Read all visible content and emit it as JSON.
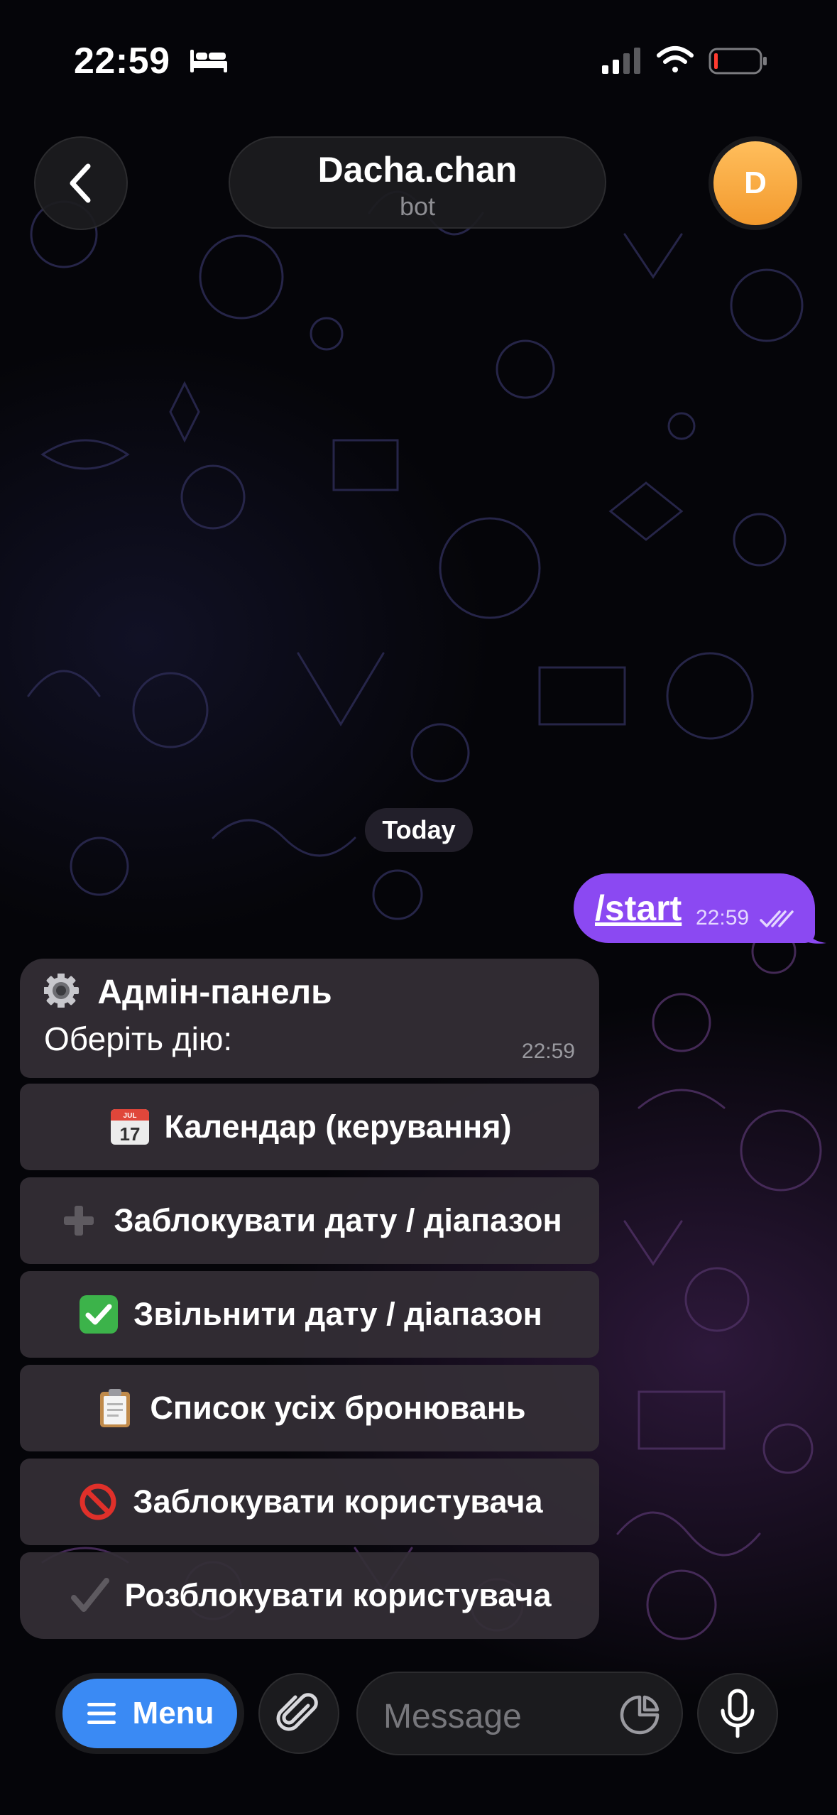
{
  "status_bar": {
    "time": "22:59"
  },
  "header": {
    "title": "Dacha.chan",
    "subtitle": "bot",
    "avatar_initial": "D"
  },
  "chat": {
    "date_chip": "Today",
    "outgoing": {
      "text": "/start",
      "time": "22:59"
    },
    "incoming": {
      "title": "Адмін-панель",
      "body": "Оберіть дію:",
      "time": "22:59",
      "buttons": [
        {
          "label": "Календар (керування)",
          "icon": "calendar-icon"
        },
        {
          "label": "Заблокувати дату / діапазон",
          "icon": "plus-icon"
        },
        {
          "label": "Звільнити дату / діапазон",
          "icon": "check-box-icon"
        },
        {
          "label": "Список усіх бронювань",
          "icon": "clipboard-icon"
        },
        {
          "label": "Заблокувати користувача",
          "icon": "no-entry-icon"
        },
        {
          "label": "Розблокувати користувача",
          "icon": "check-mark-icon"
        }
      ]
    }
  },
  "input_bar": {
    "menu_label": "Menu",
    "placeholder": "Message"
  },
  "colors": {
    "accent_purple": "#8b49f2",
    "menu_blue": "#3a8af4",
    "avatar_orange": "#f6a23a",
    "bubble_incoming": "#342e36"
  }
}
